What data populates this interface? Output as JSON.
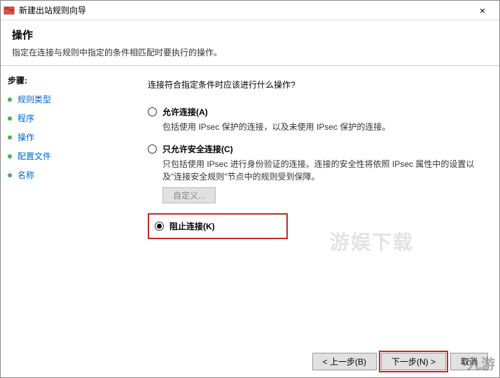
{
  "window": {
    "title": "新建出站规则向导",
    "close": "×"
  },
  "header": {
    "heading": "操作",
    "subheading": "指定在连接与规则中指定的条件相匹配时要执行的操作。"
  },
  "sidebar": {
    "title": "步骤:",
    "items": [
      {
        "label": "规则类型"
      },
      {
        "label": "程序"
      },
      {
        "label": "操作"
      },
      {
        "label": "配置文件"
      },
      {
        "label": "名称"
      }
    ]
  },
  "content": {
    "prompt": "连接符合指定条件时应该进行什么操作?",
    "options": [
      {
        "label": "允许连接(A)",
        "desc": "包括使用 IPsec 保护的连接，以及未使用 IPsec 保护的连接。",
        "selected": false
      },
      {
        "label": "只允许安全连接(C)",
        "desc": "只包括使用 IPsec 进行身份验证的连接。连接的安全性将依照 IPsec 属性中的设置以及\"连接安全规则\"节点中的规则受到保障。",
        "selected": false,
        "custom_btn": "自定义..."
      },
      {
        "label": "阻止连接(K)",
        "desc": "",
        "selected": true
      }
    ]
  },
  "footer": {
    "back": "< 上一步(B)",
    "next": "下一步(N) >",
    "cancel": "取消"
  },
  "watermark": "游娱下载",
  "logo": "九游"
}
